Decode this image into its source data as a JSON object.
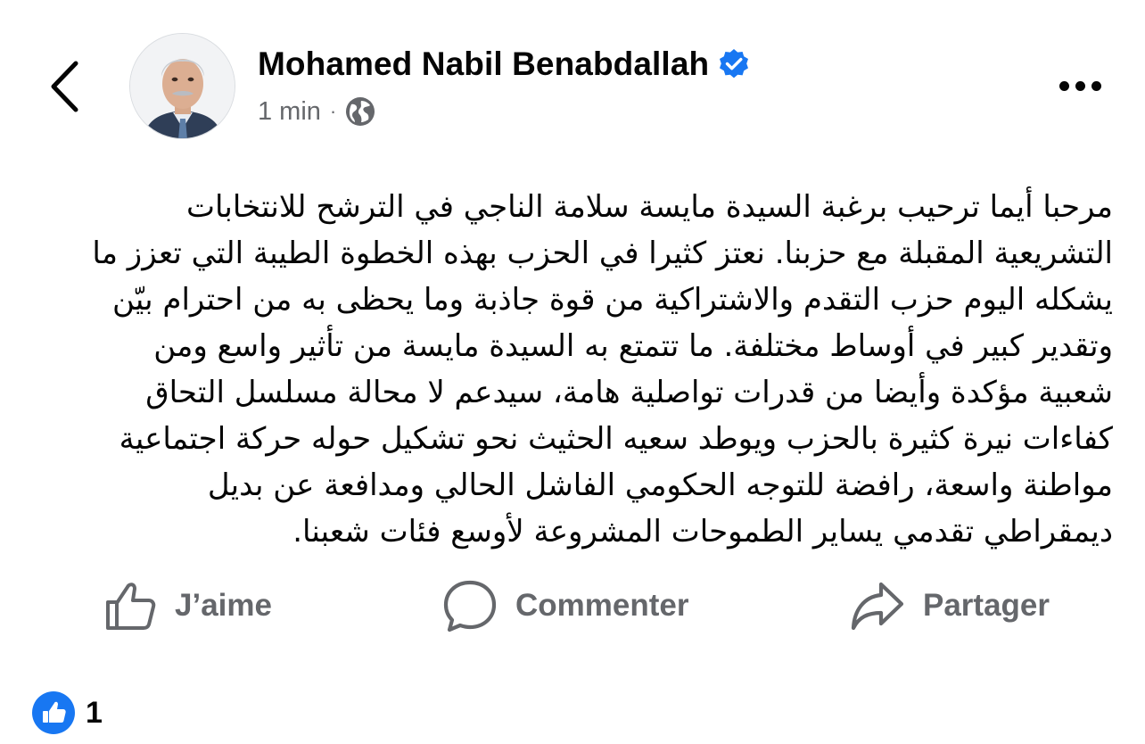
{
  "header": {
    "author_name": "Mohamed Nabil Benabdallah",
    "verified": true,
    "timestamp": "1 min",
    "separator": "·",
    "audience_icon": "globe-icon",
    "back_icon": "chevron-left-icon",
    "more_icon": "more-horizontal-icon"
  },
  "post": {
    "lines": [
      "مرحبا أيما ترحيب برغبة السيدة مايسة سلامة الناجي في الترشح للانتخابات",
      "التشريعية المقبلة مع حزبنا. نعتز كثيرا في الحزب بهذه الخطوة الطيبة التي تعزز ما",
      "يشكله اليوم حزب التقدم والاشتراكية من قوة جاذبة وما يحظى به من احترام بيّن",
      "وتقدير كبير في أوساط مختلفة. ما تتمتع به السيدة مايسة من تأثير واسع ومن",
      "شعبية مؤكدة  وأيضا من قدرات تواصلية هامة، سيدعم لا محالة مسلسل التحاق",
      "كفاءات نيرة كثيرة بالحزب ويوطد سعيه الحثيث نحو تشكيل حوله حركة اجتماعية",
      "مواطنة واسعة، رافضة للتوجه الحكومي الفاشل الحالي ومدافعة عن بديل",
      "ديمقراطي تقدمي يساير الطموحات المشروعة لأوسع فئات شعبنا."
    ]
  },
  "actions": {
    "like_label": "J’aime",
    "comment_label": "Commenter",
    "share_label": "Partager"
  },
  "reactions": {
    "count": "1",
    "icon": "thumbs-up-icon"
  },
  "colors": {
    "accent": "#1877f2",
    "secondary_text": "#65676b",
    "primary_text": "#050505"
  }
}
